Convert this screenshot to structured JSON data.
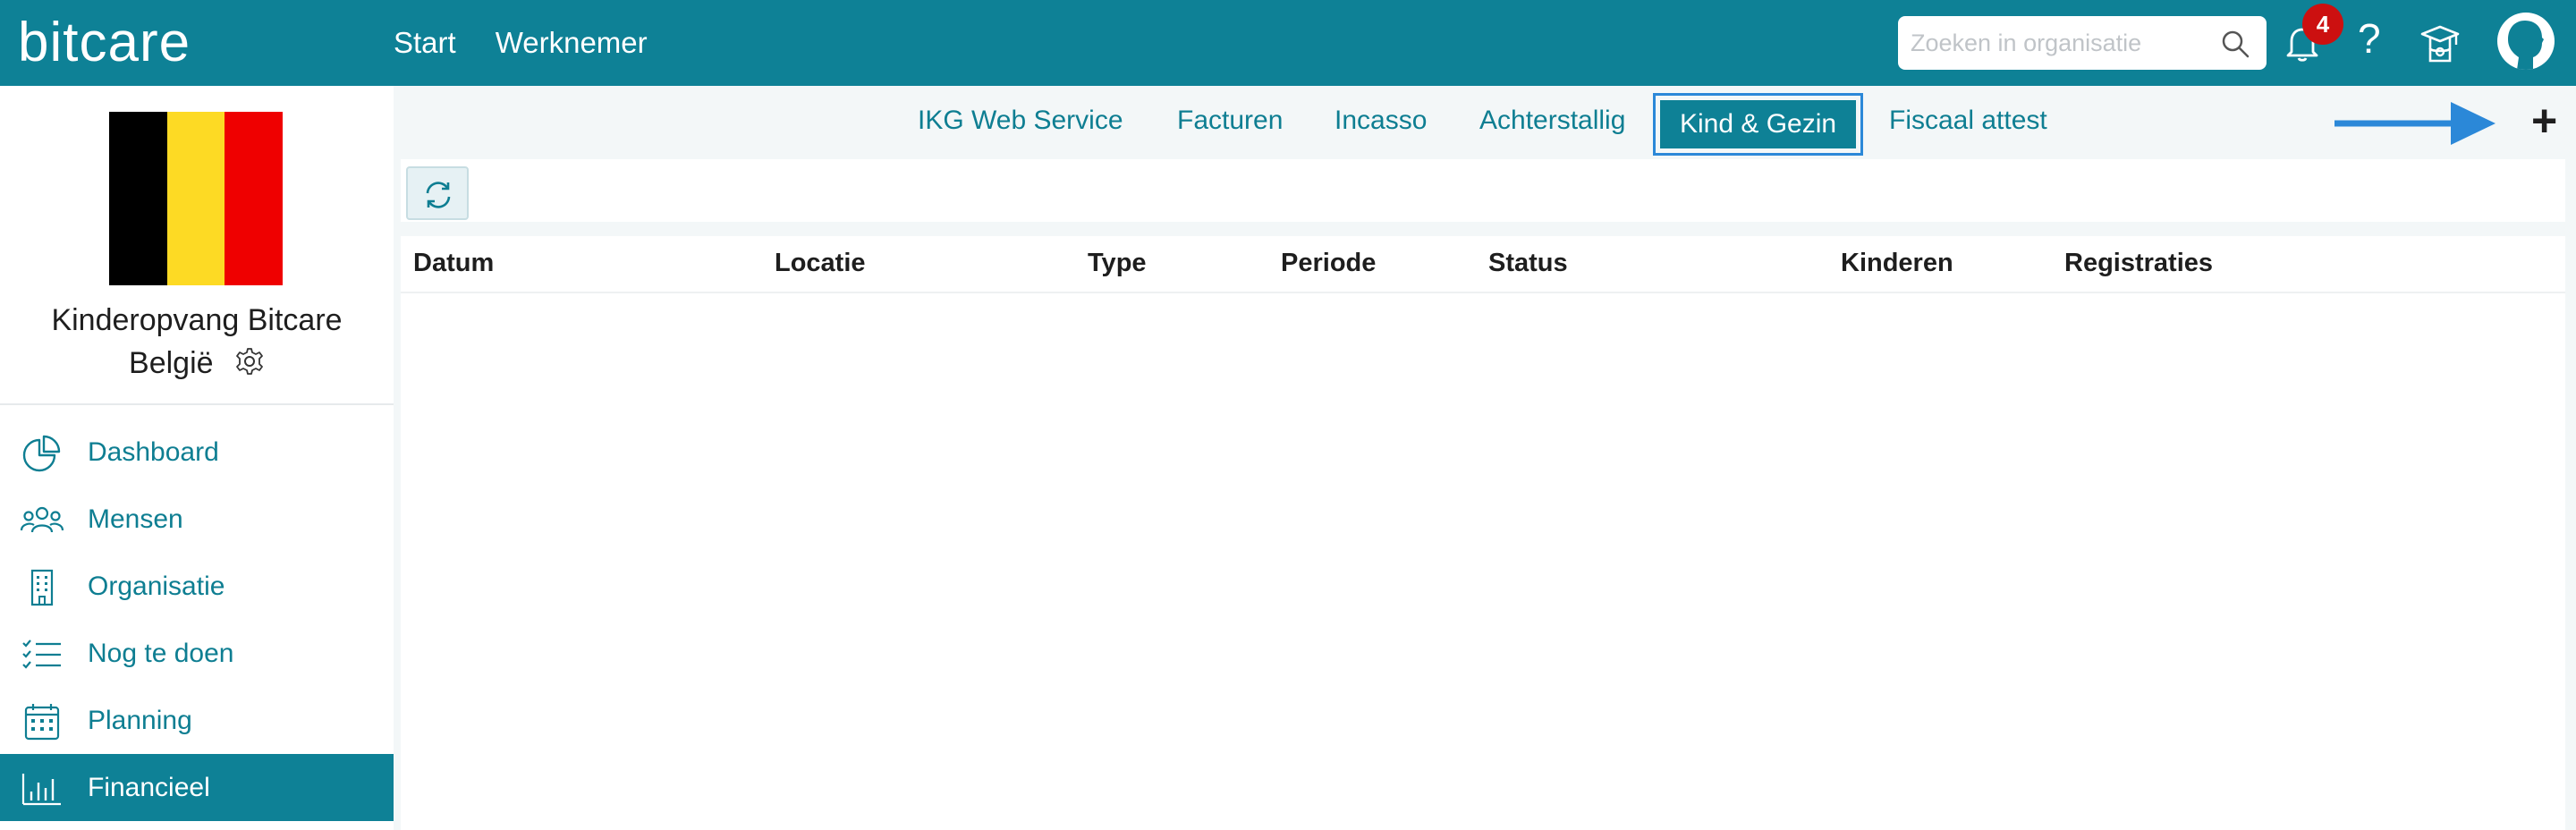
{
  "app": {
    "logo": "bitcare"
  },
  "topnav": {
    "items": [
      {
        "label": "Start"
      },
      {
        "label": "Werknemer"
      }
    ]
  },
  "search": {
    "placeholder": "Zoeken in organisatie",
    "value": ""
  },
  "notifications": {
    "count": "4"
  },
  "help": {
    "label": "?"
  },
  "organisation": {
    "name_line1": "Kinderopvang Bitcare",
    "name_line2": "België",
    "flag_colors": [
      "#000000",
      "#fdda24",
      "#ef0000"
    ]
  },
  "sidebar": {
    "items": [
      {
        "label": "Dashboard",
        "icon": "pie-chart-icon",
        "active": false
      },
      {
        "label": "Mensen",
        "icon": "people-icon",
        "active": false
      },
      {
        "label": "Organisatie",
        "icon": "building-icon",
        "active": false
      },
      {
        "label": "Nog te doen",
        "icon": "checklist-icon",
        "active": false
      },
      {
        "label": "Planning",
        "icon": "calendar-icon",
        "active": false
      },
      {
        "label": "Financieel",
        "icon": "bar-chart-icon",
        "active": true
      }
    ]
  },
  "tabs": {
    "items": [
      {
        "label": "IKG Web Service",
        "active": false
      },
      {
        "label": "Facturen",
        "active": false
      },
      {
        "label": "Incasso",
        "active": false
      },
      {
        "label": "Achterstallig",
        "active": false
      },
      {
        "label": "Kind & Gezin",
        "active": true
      },
      {
        "label": "Fiscaal attest",
        "active": false
      }
    ],
    "add_label": "+"
  },
  "table": {
    "columns": [
      "Datum",
      "Locatie",
      "Type",
      "Periode",
      "Status",
      "Kinderen",
      "Registraties"
    ],
    "rows": []
  },
  "colors": {
    "brand": "#0e8196",
    "accent_text": "#0e7e92",
    "badge": "#cc1010",
    "arrow": "#2b88d8"
  }
}
